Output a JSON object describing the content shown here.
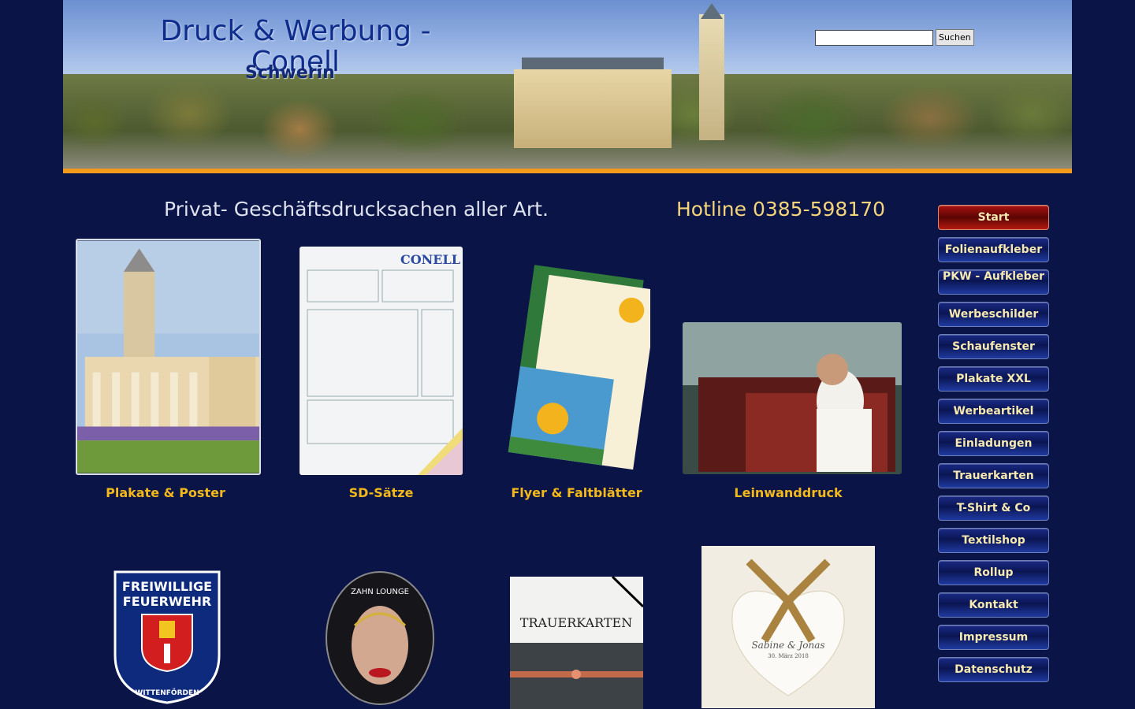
{
  "header": {
    "brand_line1": "Druck & Werbung -",
    "brand_line2": "Conell",
    "brand_sub": "Schwerin",
    "search_placeholder": "",
    "search_button": "Suchen"
  },
  "tagline": "Privat- Geschäftsdrucksachen aller Art.",
  "hotline": "Hotline 0385-598170",
  "products": [
    {
      "label": "Plakate & Poster"
    },
    {
      "label": "SD-Sätze"
    },
    {
      "label": "Flyer & Faltblätter"
    },
    {
      "label": "Leinwanddruck"
    }
  ],
  "bottom_images": {
    "badge_lines": [
      "FREIWILLIGE",
      "FEUERWEHR"
    ],
    "badge_ring": "WITTENFÖRDEN",
    "button_text": "ZAHN LOUNGE",
    "trauer_text": "TRAUERKARTEN",
    "invite_names": "Sabine & Jonas",
    "invite_date": "30. März 2018"
  },
  "nav": [
    {
      "label": "Start",
      "active": true
    },
    {
      "label": "Folienaufkleber"
    },
    {
      "label": "PKW - Aufkleber"
    },
    {
      "label": "Werbeschilder"
    },
    {
      "label": "Schaufenster"
    },
    {
      "label": "Plakate XXL"
    },
    {
      "label": "Werbeartikel"
    },
    {
      "label": "Einladungen"
    },
    {
      "label": "Trauerkarten"
    },
    {
      "label": "T-Shirt & Co"
    },
    {
      "label": "Textilshop"
    },
    {
      "label": "Rollup"
    },
    {
      "label": "Kontakt"
    },
    {
      "label": "Impressum"
    },
    {
      "label": "Datenschutz"
    }
  ],
  "colors": {
    "background": "#0a1447",
    "accent_orange": "#f39a1d",
    "product_label": "#f3b81c",
    "hotline": "#f5d579"
  }
}
